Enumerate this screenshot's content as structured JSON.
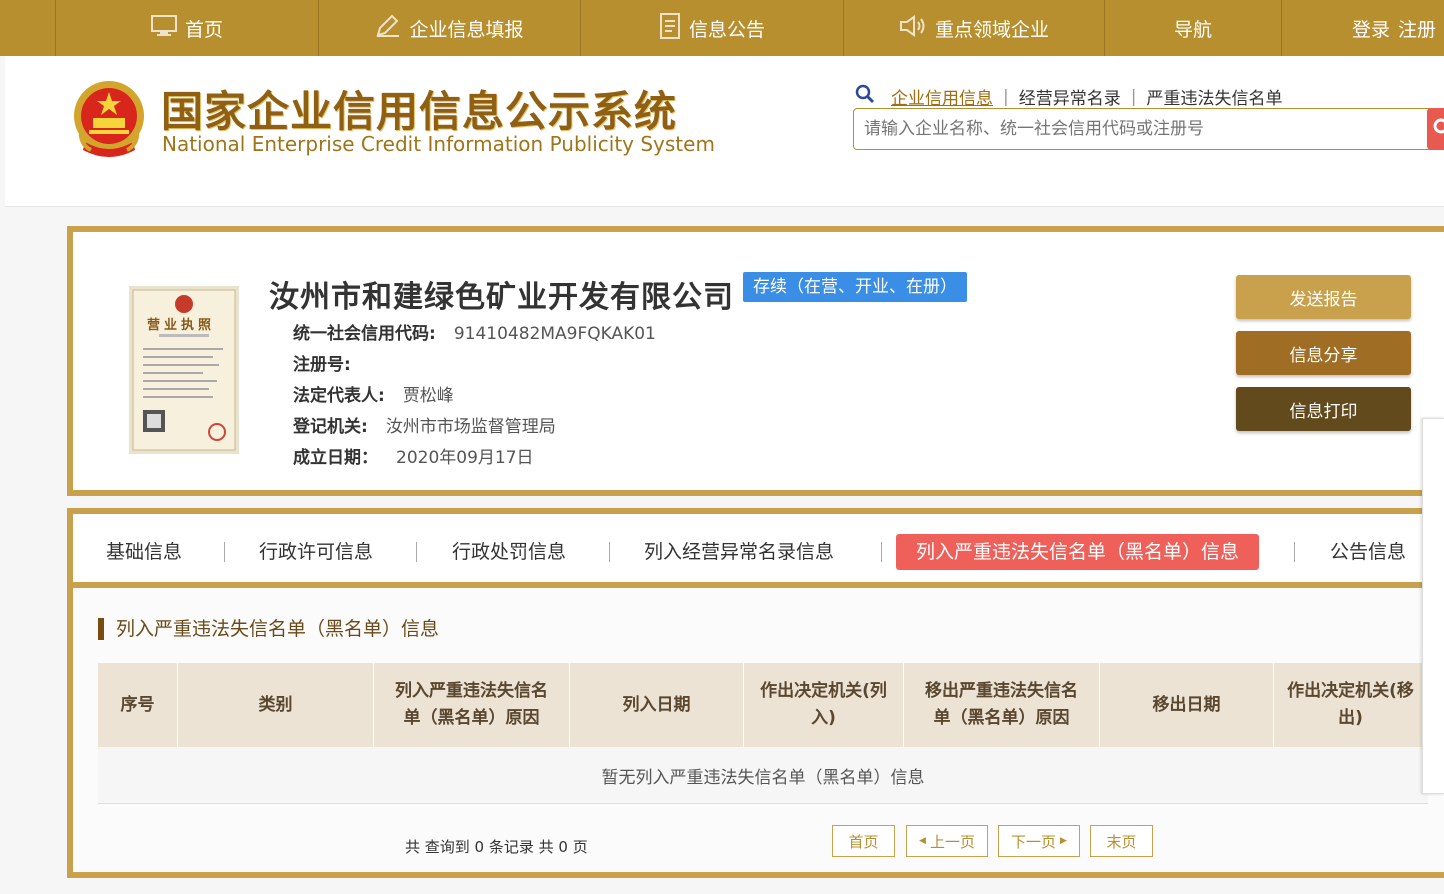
{
  "topnav": {
    "items": [
      {
        "label": "首页",
        "icon": "monitor-icon"
      },
      {
        "label": "企业信息填报",
        "icon": "edit-icon"
      },
      {
        "label": "信息公告",
        "icon": "document-icon"
      },
      {
        "label": "重点领域企业",
        "icon": "speaker-icon"
      },
      {
        "label": "导航",
        "icon": ""
      }
    ],
    "login": "登录",
    "register": "注册"
  },
  "header": {
    "title": "国家企业信用信息公示系统",
    "subtitle": "National Enterprise Credit Information Publicity System",
    "search_links": [
      "企业信用信息",
      "经营异常名录",
      "严重违法失信名单"
    ],
    "search_placeholder": "请输入企业名称、统一社会信用代码或注册号"
  },
  "company": {
    "name": "汝州市和建绿色矿业开发有限公司",
    "status": "存续（在营、开业、在册）",
    "license_title": "营业执照",
    "fields": [
      {
        "key": "统一社会信用代码:",
        "value": "91410482MA9FQKAK01"
      },
      {
        "key": "注册号:",
        "value": ""
      },
      {
        "key": "法定代表人:",
        "value": "贾松峰"
      },
      {
        "key": "登记机关:",
        "value": "汝州市市场监督管理局"
      },
      {
        "key": "成立日期：",
        "value": "2020年09月17日"
      }
    ],
    "buttons": [
      "发送报告",
      "信息分享",
      "信息打印"
    ]
  },
  "tabs": [
    "基础信息",
    "行政许可信息",
    "行政处罚信息",
    "列入经营异常名录信息",
    "列入严重违法失信名单（黑名单）信息",
    "公告信息"
  ],
  "active_tab": 4,
  "section": {
    "title": "列入严重违法失信名单（黑名单）信息",
    "columns": [
      "序号",
      "类别",
      "列入严重违法失信名单（黑名单）原因",
      "列入日期",
      "作出决定机关(列入)",
      "移出严重违法失信名单（黑名单）原因",
      "移出日期",
      "作出决定机关(移出)"
    ],
    "empty_text": "暂无列入严重违法失信名单（黑名单）信息",
    "pager_info": "共 查询到 0 条记录 共 0 页",
    "pager": [
      "首页",
      "上一页",
      "下一页",
      "末页"
    ]
  },
  "colors": {
    "gold": "#b88f2e",
    "active_tab": "#f0605a",
    "status": "#3b8ee6"
  }
}
